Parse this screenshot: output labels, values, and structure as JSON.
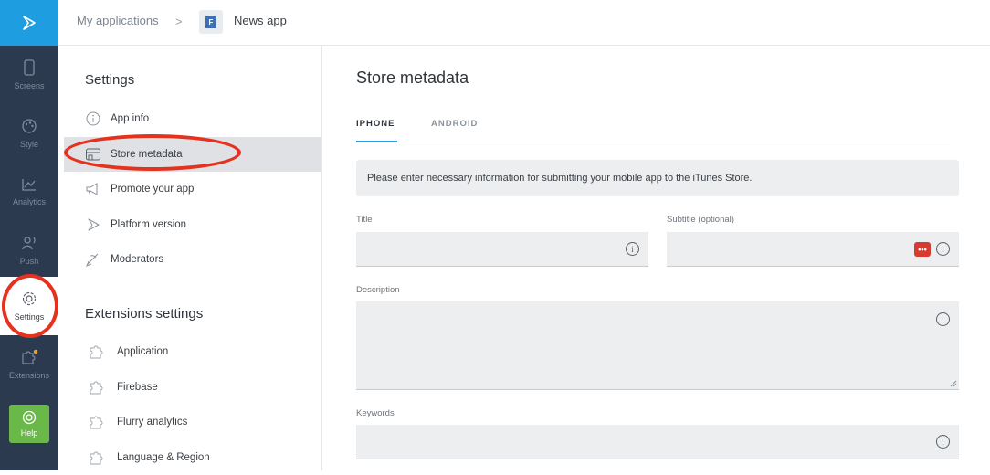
{
  "rail": {
    "items": [
      {
        "label": "Screens",
        "icon": "phone-icon"
      },
      {
        "label": "Style",
        "icon": "palette-icon"
      },
      {
        "label": "Analytics",
        "icon": "chart-icon"
      },
      {
        "label": "Push",
        "icon": "push-icon"
      },
      {
        "label": "Settings",
        "icon": "gear-icon"
      },
      {
        "label": "Extensions",
        "icon": "puzzle-icon"
      }
    ],
    "help_label": "Help"
  },
  "breadcrumb": {
    "root": "My applications",
    "separator": ">",
    "app_icon_letter": "F",
    "app_name": "News app"
  },
  "sidebar": {
    "settings_title": "Settings",
    "settings_items": [
      {
        "label": "App info",
        "icon": "info-icon"
      },
      {
        "label": "Store metadata",
        "icon": "store-icon"
      },
      {
        "label": "Promote your app",
        "icon": "megaphone-icon"
      },
      {
        "label": "Platform version",
        "icon": "platform-icon"
      },
      {
        "label": "Moderators",
        "icon": "moderators-icon"
      }
    ],
    "extensions_title": "Extensions settings",
    "extension_items": [
      {
        "label": "Application",
        "icon": "puzzle-icon"
      },
      {
        "label": "Firebase",
        "icon": "puzzle-icon"
      },
      {
        "label": "Flurry analytics",
        "icon": "puzzle-icon"
      },
      {
        "label": "Language & Region",
        "icon": "puzzle-icon"
      }
    ]
  },
  "main": {
    "title": "Store metadata",
    "tabs": [
      {
        "label": "IPHONE",
        "active": true
      },
      {
        "label": "ANDROID",
        "active": false
      }
    ],
    "banner": "Please enter necessary information for submitting your mobile app to the iTunes Store.",
    "fields": {
      "title_label": "Title",
      "title_value": "",
      "subtitle_label": "Subtitle (optional)",
      "subtitle_value": "",
      "description_label": "Description",
      "description_value": "",
      "keywords_label": "Keywords",
      "keywords_value": "",
      "info_glyph": "i",
      "password_manager_glyph": "•••"
    }
  },
  "colors": {
    "accent": "#1e9ee0",
    "rail_bg": "#2c3a50",
    "help_green": "#6bb84a",
    "annotation_red": "#e5321f"
  }
}
